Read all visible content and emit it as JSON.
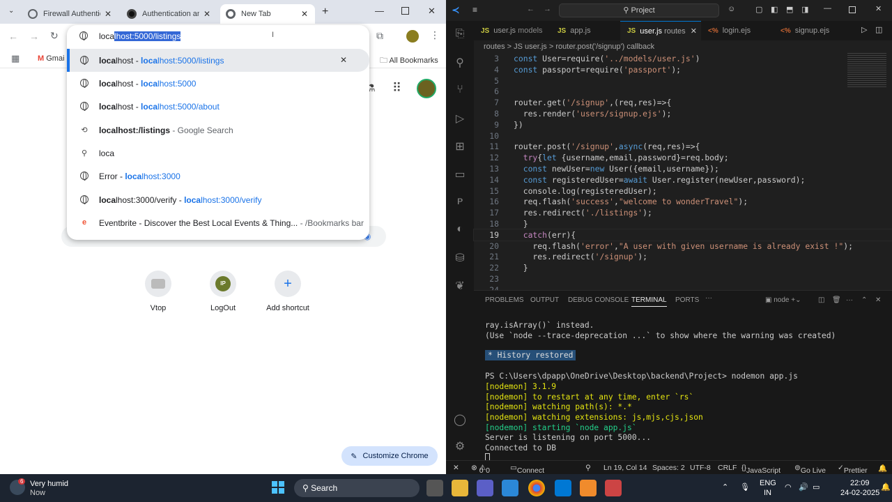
{
  "chrome": {
    "tabs": [
      {
        "title": "Firewall Authentica"
      },
      {
        "title": "Authentication an"
      },
      {
        "title": "New Tab"
      }
    ],
    "omnibox": {
      "typed": "loca",
      "completion": "lhost:5000/listings"
    },
    "suggestions": [
      {
        "bold": "loca",
        "rest": "lhost - ",
        "url_bold": "loca",
        "url_rest": "lhost:5000/listings",
        "icon": "globe-icon"
      },
      {
        "bold": "loca",
        "rest": "lhost - ",
        "url_bold": "loca",
        "url_rest": "lhost:5000",
        "icon": "globe-icon"
      },
      {
        "bold": "loca",
        "rest": "lhost - ",
        "url_bold": "loca",
        "url_rest": "lhost:5000/about",
        "icon": "globe-icon"
      },
      {
        "bold": "loca",
        "rest": "lhost:/listings",
        "url_bold": "",
        "url_rest": " - Google Search",
        "icon": "history-icon"
      },
      {
        "bold": "",
        "rest": "loca",
        "url_bold": "",
        "url_rest": "",
        "icon": "search-icon"
      },
      {
        "bold": "",
        "rest": "Error - ",
        "url_bold": "loca",
        "url_rest": "lhost:3000",
        "icon": "globe-icon"
      },
      {
        "bold": "loca",
        "rest": "lhost:3000/verify - ",
        "url_bold": "loca",
        "url_rest": "lhost:3000/verify",
        "icon": "globe-icon"
      },
      {
        "bold": "",
        "rest": "Eventbrite - Discover the Best Local Events & Thing...",
        "url_bold": "",
        "url_rest": " - /Bookmarks bar",
        "icon": "eventbrite-icon"
      }
    ],
    "bookmarks": {
      "gmail": "Gmai",
      "all": "All Bookmarks"
    },
    "shortcuts": [
      {
        "label": "Vtop"
      },
      {
        "label": "LogOut",
        "initials": "IP"
      },
      {
        "label": "Add shortcut",
        "glyph": "+"
      }
    ],
    "customize": "Customize Chrome"
  },
  "vscode": {
    "search": "Project",
    "tabs": [
      {
        "kind": "JS",
        "name": "user.js",
        "desc": "models"
      },
      {
        "kind": "JS",
        "name": "app.js",
        "desc": ""
      },
      {
        "kind": "JS",
        "name": "user.js",
        "desc": "routes"
      },
      {
        "kind": "<%",
        "name": "login.ejs",
        "desc": ""
      },
      {
        "kind": "<%",
        "name": "signup.ejs",
        "desc": ""
      }
    ],
    "breadcrumb": [
      "routes",
      "JS user.js",
      "router.post('/signup') callback"
    ],
    "code": [
      {
        "n": "3",
        "text": "const User=require('../models/user.js')"
      },
      {
        "n": "4",
        "text": "const passport=require('passport');"
      },
      {
        "n": "5",
        "text": ""
      },
      {
        "n": "6",
        "text": ""
      },
      {
        "n": "7",
        "text": "router.get('/signup',(req,res)=>{"
      },
      {
        "n": "8",
        "text": "  res.render('users/signup.ejs');"
      },
      {
        "n": "9",
        "text": "})"
      },
      {
        "n": "10",
        "text": ""
      },
      {
        "n": "11",
        "text": "router.post('/signup',async(req,res)=>{"
      },
      {
        "n": "12",
        "text": "  try{let {username,email,password}=req.body;"
      },
      {
        "n": "13",
        "text": "  const newUser=new User({email,username});"
      },
      {
        "n": "14",
        "text": "  const registeredUser=await User.register(newUser,password);"
      },
      {
        "n": "15",
        "text": "  console.log(registeredUser);"
      },
      {
        "n": "16",
        "text": "  req.flash('success',\"welcome to wonderTravel\");"
      },
      {
        "n": "17",
        "text": "  res.redirect('./listings');"
      },
      {
        "n": "18",
        "text": "  }"
      },
      {
        "n": "19",
        "text": "  catch(err){"
      },
      {
        "n": "20",
        "text": "    req.flash('error',\"A user with given username is already exist !\");"
      },
      {
        "n": "21",
        "text": "    res.redirect('/signup');"
      },
      {
        "n": "22",
        "text": "  }"
      },
      {
        "n": "23",
        "text": ""
      },
      {
        "n": "24",
        "text": ""
      }
    ],
    "panel_tabs": [
      "PROBLEMS",
      "OUTPUT",
      "DEBUG CONSOLE",
      "TERMINAL",
      "PORTS"
    ],
    "terminal_label": "node",
    "terminal": {
      "l1": "ray.isArray()` instead.",
      "l2": "(Use `node --trace-deprecation ...` to show where the warning was created)",
      "history": "History restored",
      "prompt": "PS C:\\Users\\dpapp\\OneDrive\\Desktop\\backend\\Project> nodemon app.js",
      "n1": "[nodemon] 3.1.9",
      "n2": "[nodemon] to restart at any time, enter `rs`",
      "n3": "[nodemon] watching path(s): *.*",
      "n4": "[nodemon] watching extensions: js,mjs,cjs,json",
      "n5": "[nodemon] starting `node app.js`",
      "s1": "Server is listening on port 5000...",
      "s2": "Connected to DB"
    },
    "status": {
      "errors": "0",
      "warnings": "0",
      "connect": "Connect",
      "pos": "Ln 19, Col 14",
      "spaces": "Spaces: 2",
      "enc": "UTF-8",
      "eol": "CRLF",
      "lang": "JavaScript",
      "live": "Go Live",
      "prettier": "Prettier"
    }
  },
  "taskbar": {
    "weather": "Very humid",
    "weather_sub": "Now",
    "badge": "6",
    "search": "Search",
    "lang": "ENG",
    "region": "IN",
    "time": "22:09",
    "date": "24-02-2025"
  }
}
